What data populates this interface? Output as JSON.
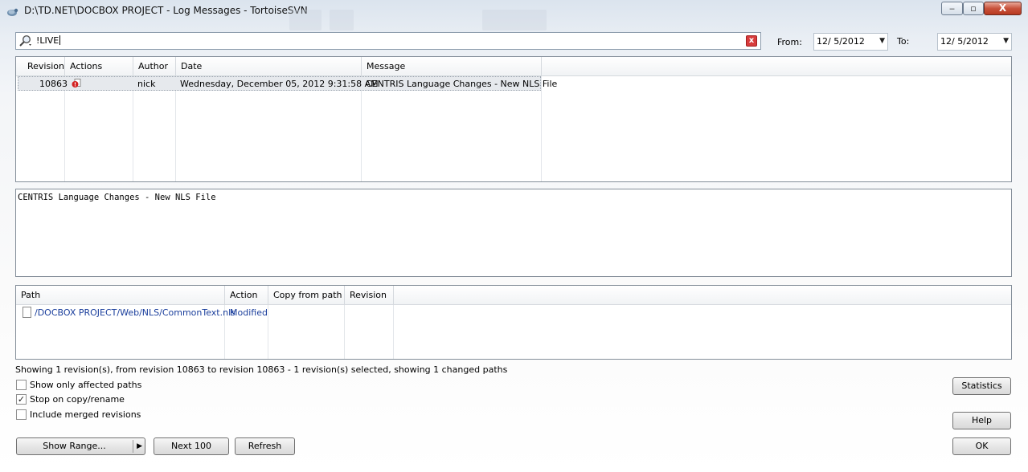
{
  "window": {
    "title": "D:\\TD.NET\\DOCBOX PROJECT - Log Messages - TortoiseSVN",
    "minimize_glyph": "‒",
    "maximize_glyph": "▫",
    "close_glyph": "X"
  },
  "filter": {
    "search_text": "!LIVE",
    "clear_glyph": "x",
    "from_label": "From:",
    "from_date": "12/  5/2012",
    "to_label": "To:",
    "to_date": "12/  5/2012",
    "dropdown_glyph": "▼"
  },
  "log_table": {
    "columns": [
      "Revision",
      "Actions",
      "Author",
      "Date",
      "Message"
    ],
    "rows": [
      {
        "revision": "10863",
        "actions_icon": "modified-action-icon",
        "author": "nick",
        "date": "Wednesday, December 05, 2012 9:31:58 AM",
        "message": "CENTRIS Language Changes - New NLS File"
      }
    ]
  },
  "message_panel": {
    "text": "CENTRIS Language Changes - New NLS File"
  },
  "paths_table": {
    "columns": [
      "Path",
      "Action",
      "Copy from path",
      "Revision"
    ],
    "rows": [
      {
        "icon": "file-icon",
        "path": "/DOCBOX PROJECT/Web/NLS/CommonText.nls",
        "action": "Modified",
        "copy_from_path": "",
        "revision": ""
      }
    ]
  },
  "status_text": "Showing 1 revision(s), from revision 10863 to revision 10863 - 1 revision(s) selected, showing 1 changed paths",
  "options": [
    {
      "label": "Show only affected paths",
      "checked": false,
      "mark": ""
    },
    {
      "label": "Stop on copy/rename",
      "checked": true,
      "mark": "✓"
    },
    {
      "label": "Include merged revisions",
      "checked": false,
      "mark": ""
    }
  ],
  "buttons": {
    "show_range": "Show Range...",
    "show_range_arrow": "▶",
    "next_100": "Next 100",
    "refresh": "Refresh",
    "statistics": "Statistics",
    "help": "Help",
    "ok": "OK"
  },
  "colors": {
    "link_blue": "#1a3e9c",
    "close_red": "#c8523c"
  }
}
